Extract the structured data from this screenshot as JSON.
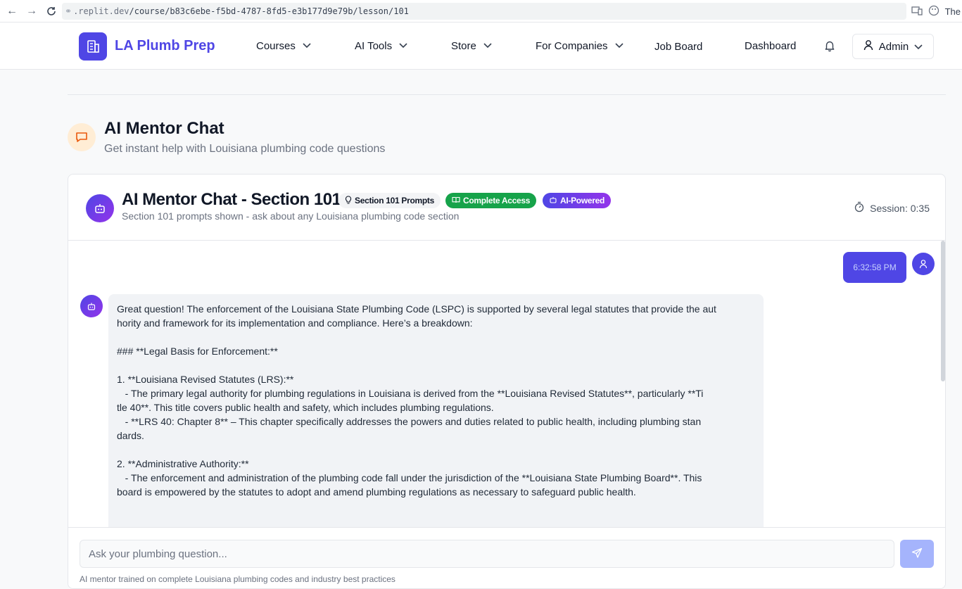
{
  "browser": {
    "url_host": ".replit.dev",
    "url_path": "/course/b83c6ebe-f5bd-4787-8fd5-e3b177d9e79b/lesson/101",
    "right_text": "The"
  },
  "header": {
    "logo_text": "LA Plumb Prep",
    "nav": {
      "courses": "Courses",
      "ai_tools": "AI Tools",
      "store": "Store",
      "for_companies": "For Companies",
      "job_board": "Job Board",
      "dashboard": "Dashboard"
    },
    "user_label": "Admin"
  },
  "page": {
    "title": "AI Mentor Chat",
    "subtitle": "Get instant help with Louisiana plumbing code questions"
  },
  "chat": {
    "title": "AI Mentor Chat - Section 101",
    "subtitle": "Section 101 prompts shown - ask about any Louisiana plumbing code section",
    "badges": {
      "prompts": "Section 101 Prompts",
      "access": "Complete Access",
      "ai": "AI-Powered"
    },
    "session": "Session: 0:35",
    "user_message_time": "6:32:58 PM",
    "bot_message": "Great question! The enforcement of the Louisiana State Plumbing Code (LSPC) is supported by several legal statutes that provide the aut\nhority and framework for its implementation and compliance. Here’s a breakdown:\n\n### **Legal Basis for Enforcement:**\n\n1. **Louisiana Revised Statutes (LRS):**\n   - The primary legal authority for plumbing regulations in Louisiana is derived from the **Louisiana Revised Statutes**, particularly **Ti\ntle 40**. This title covers public health and safety, which includes plumbing regulations.\n   - **LRS 40: Chapter 8** – This chapter specifically addresses the powers and duties related to public health, including plumbing stan\ndards.\n\n2. **Administrative Authority:**\n   - The enforcement and administration of the plumbing code fall under the jurisdiction of the **Louisiana State Plumbing Board**. This\nboard is empowered by the statutes to adopt and amend plumbing regulations as necessary to safeguard public health.",
    "input_placeholder": "Ask your plumbing question...",
    "footer_note": "AI mentor trained on complete Louisiana plumbing codes and industry best practices"
  },
  "colors": {
    "brand": "#4f46e5",
    "accent_green": "#16a34a",
    "accent_purple": "#9333ea",
    "send_disabled": "#a5b4fc"
  }
}
